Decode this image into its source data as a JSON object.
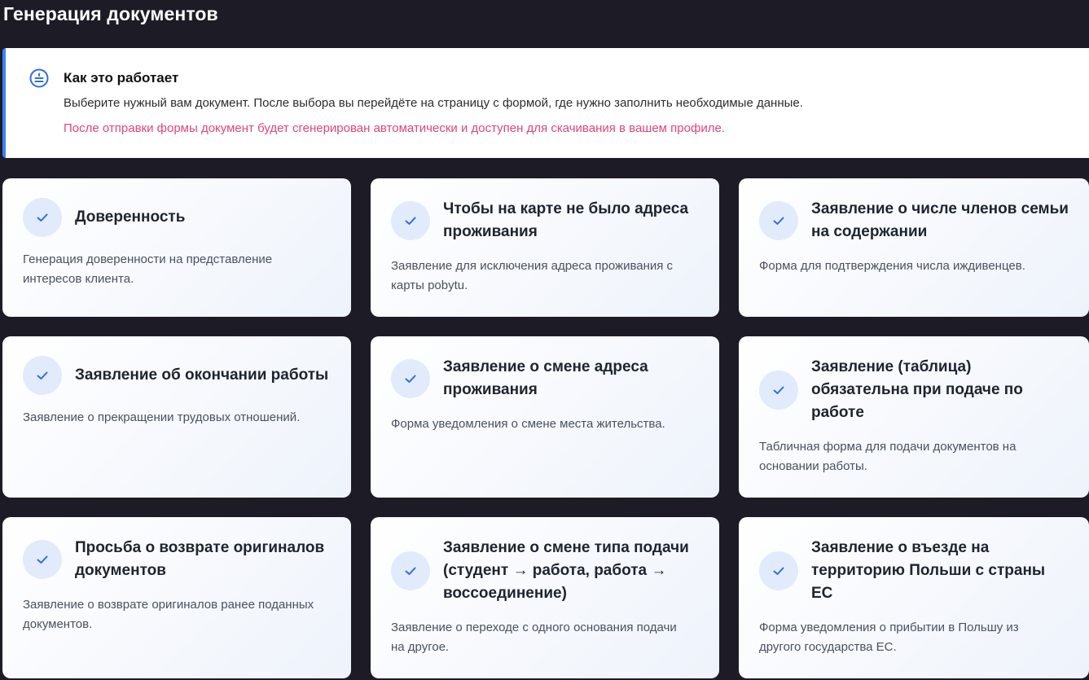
{
  "page": {
    "title": "Генерация документов"
  },
  "info": {
    "icon": "info-list-icon",
    "title": "Как это работает",
    "text": "Выберите нужный вам документ. После выбора вы перейдёте на страницу с формой, где нужно заполнить необходимые данные.",
    "note": "После отправки формы документ будет сгенерирован автоматически и доступен для скачивания в вашем профиле.",
    "accent_color": "#3b82f6",
    "note_color": "#e0457b"
  },
  "cards": [
    {
      "title": "Доверенность",
      "description": "Генерация доверенности на представление интересов клиента."
    },
    {
      "title": "Чтобы на карте не было адреса проживания",
      "description": "Заявление для исключения адреса проживания с карты pobytu."
    },
    {
      "title": "Заявление о числе членов семьи на содержании",
      "description": "Форма для подтверждения числа иждивенцев."
    },
    {
      "title": "Заявление об окончании работы",
      "description": "Заявление о прекращении трудовых отношений."
    },
    {
      "title": "Заявление о смене адреса проживания",
      "description": "Форма уведомления о смене места жительства."
    },
    {
      "title": "Заявление (таблица) обязательна при подаче по работе",
      "description": "Табличная форма для подачи документов на основании работы."
    },
    {
      "title": "Просьба о возврате оригиналов документов",
      "description": "Заявление о возврате оригиналов ранее поданных документов."
    },
    {
      "title": "Заявление о смене типа подачи (студент → работа, работа → воссоединение)",
      "description": "Заявление о переходе с одного основания подачи на другое."
    },
    {
      "title": "Заявление о въезде на территорию Польши с страны ЕС",
      "description": "Форма уведомления о прибытии в Польшу из другого государства ЕС."
    }
  ],
  "colors": {
    "background": "#1c1b26",
    "check_circle": "#e1ebfb",
    "check_mark": "#2f6fdb"
  }
}
